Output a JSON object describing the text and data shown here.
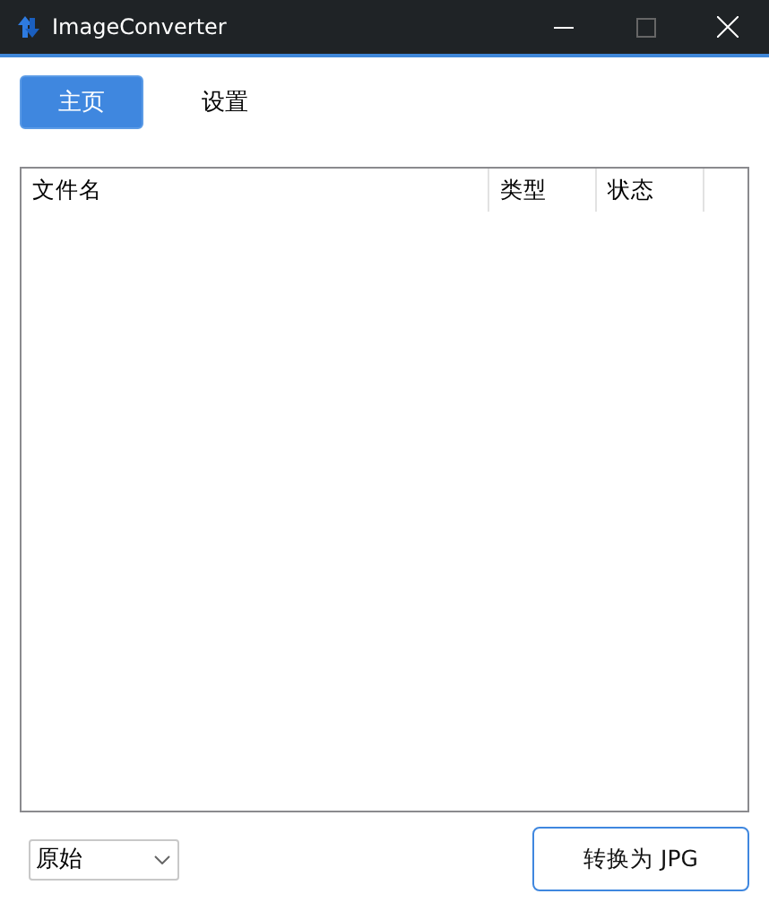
{
  "window": {
    "title": "ImageConverter"
  },
  "tabs": [
    {
      "label": "主页",
      "selected": true
    },
    {
      "label": "设置",
      "selected": false
    }
  ],
  "table": {
    "columns": [
      "文件名",
      "类型",
      "状态"
    ]
  },
  "quality_select": {
    "value": "原始"
  },
  "convert_button": {
    "label": "转换为 JPG"
  }
}
